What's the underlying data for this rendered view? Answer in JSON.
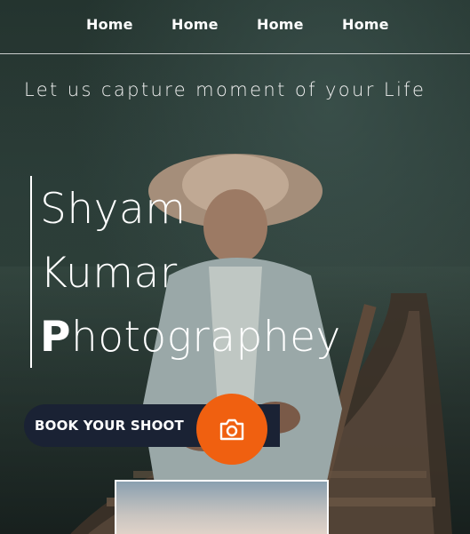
{
  "nav": {
    "items": [
      {
        "label": "Home"
      },
      {
        "label": "Home"
      },
      {
        "label": "Home"
      },
      {
        "label": "Home"
      }
    ]
  },
  "hero": {
    "tagline": "Let us capture moment of your Life",
    "title_line1": "Shyam",
    "title_line2": "Kumar",
    "title_line3_initial": "P",
    "title_line3_rest": "hotographey"
  },
  "cta": {
    "book_label": "BOOK YOUR SHOOT",
    "icon": "camera-icon",
    "accent_color": "#f06010",
    "bar_color": "#1a2234"
  }
}
